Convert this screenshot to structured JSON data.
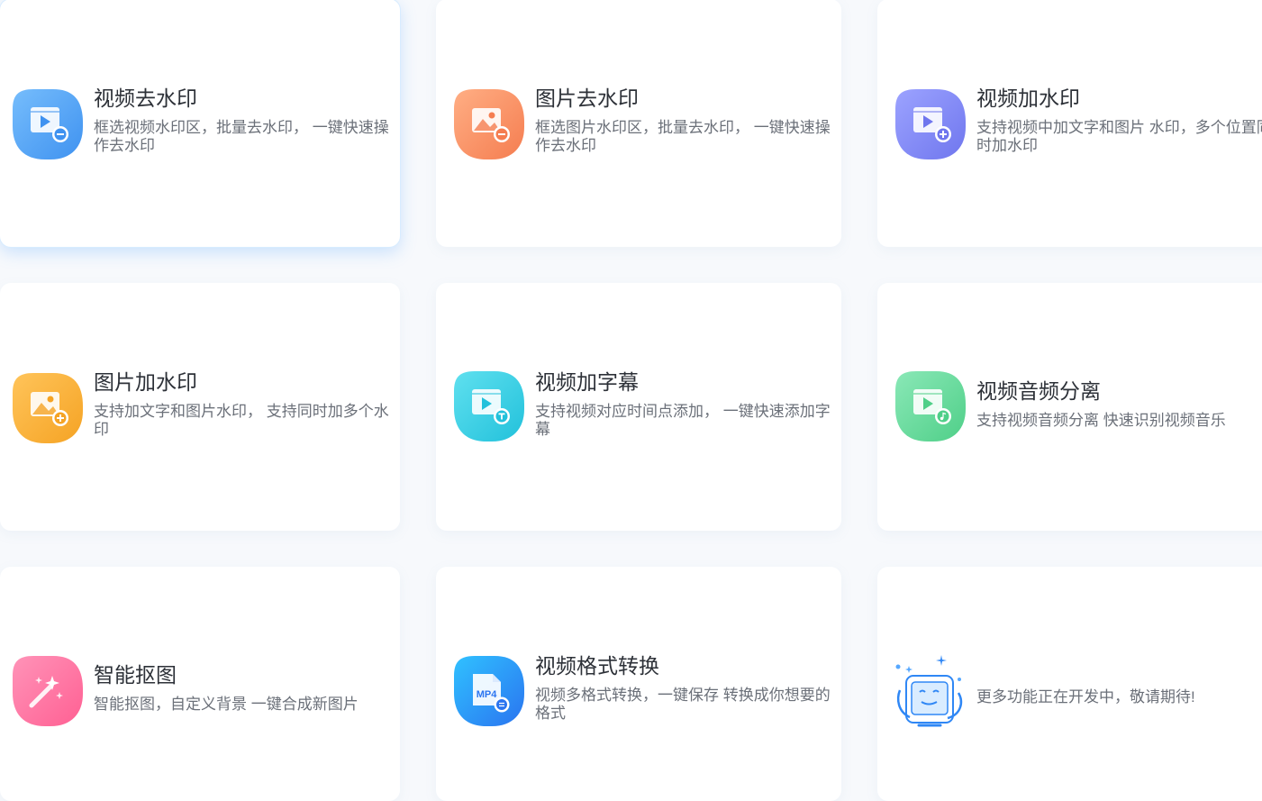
{
  "features": [
    {
      "title": "视频去水印",
      "desc": "框选视频水印区，批量去水印， 一键快速操作去水印",
      "icon": "video-remove-watermark-icon",
      "color": "#4da1f5"
    },
    {
      "title": "图片去水印",
      "desc": "框选图片水印区，批量去水印， 一键快速操作去水印",
      "icon": "image-remove-watermark-icon",
      "color": "#f58b60"
    },
    {
      "title": "视频加水印",
      "desc": "支持视频中加文字和图片 水印，多个位置同时加水印",
      "icon": "video-add-watermark-icon",
      "color": "#7b82f4"
    },
    {
      "title": "图片加水印",
      "desc": "支持加文字和图片水印， 支持同时加多个水印",
      "icon": "image-add-watermark-icon",
      "color": "#f6ad35"
    },
    {
      "title": "视频加字幕",
      "desc": "支持视频对应时间点添加， 一键快速添加字幕",
      "icon": "video-subtitle-icon",
      "color": "#31cbe0"
    },
    {
      "title": "视频音频分离",
      "desc": "支持视频音频分离 快速识别视频音乐",
      "icon": "audio-separation-icon",
      "color": "#64d79b"
    },
    {
      "title": "智能抠图",
      "desc": "智能抠图，自定义背景 一键合成新图片",
      "icon": "magic-wand-icon",
      "color": "#ff6f9e"
    },
    {
      "title": "视频格式转换",
      "desc": "视频多格式转换，一键保存 转换成你想要的格式",
      "icon": "mp4-format-icon",
      "badge_text": "MP4",
      "color": "#2589f5"
    }
  ],
  "coming_soon": {
    "text": "更多功能正在开发中，敬请期待!",
    "icon": "coming-soon-illustration-icon"
  }
}
